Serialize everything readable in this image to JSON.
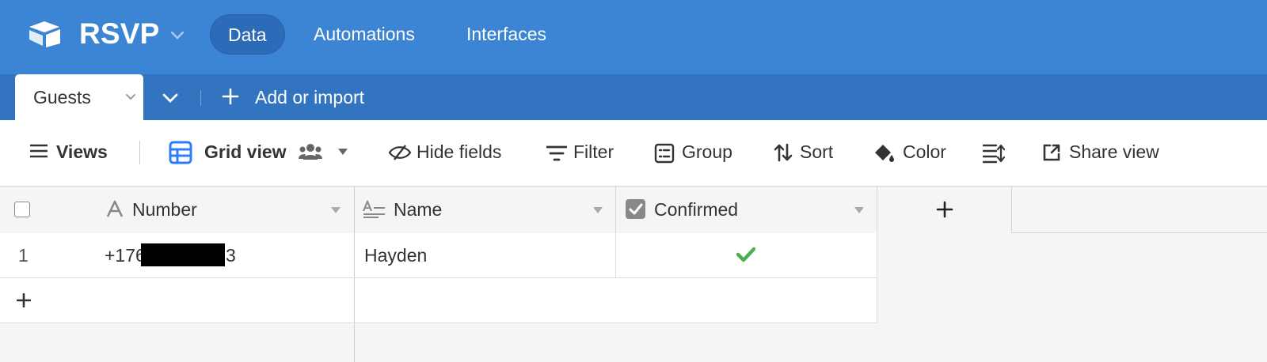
{
  "app": {
    "base_name": "RSVP",
    "nav": [
      {
        "label": "Data",
        "active": true
      },
      {
        "label": "Automations",
        "active": false
      },
      {
        "label": "Interfaces",
        "active": false
      }
    ],
    "brand_color": "#3b85d4"
  },
  "tables": {
    "active_tab": "Guests",
    "add_import_label": "Add or import"
  },
  "toolbar": {
    "views_label": "Views",
    "grid_view_label": "Grid view",
    "hide_fields_label": "Hide fields",
    "filter_label": "Filter",
    "group_label": "Group",
    "sort_label": "Sort",
    "color_label": "Color",
    "share_view_label": "Share view"
  },
  "grid": {
    "columns": [
      {
        "name": "Number",
        "icon": "text-a-icon"
      },
      {
        "name": "Name",
        "icon": "long-text-icon"
      },
      {
        "name": "Confirmed",
        "icon": "checkbox-icon"
      }
    ],
    "add_column_symbol": "+",
    "rows": [
      {
        "index": "1",
        "number_prefix": "+176",
        "number_suffix": "3",
        "name": "Hayden",
        "confirmed": true
      }
    ],
    "add_row_symbol": "+",
    "checkmark_color": "#4caf50"
  }
}
